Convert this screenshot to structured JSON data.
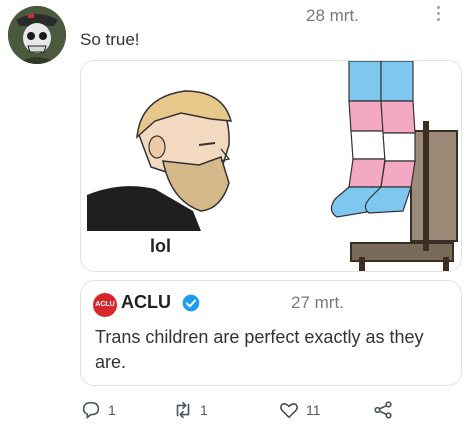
{
  "post": {
    "text": "So true!",
    "timestamp": "28 mrt.",
    "meme_caption": "lol"
  },
  "quoted": {
    "logo_text": "ACLU",
    "name": "ACLU",
    "timestamp": "27 mrt.",
    "text": "Trans children are perfect exactly as they are."
  },
  "actions": {
    "replies": "1",
    "retweets": "1",
    "likes": "11"
  },
  "colors": {
    "verified": "#1d9bf0",
    "aclu_red": "#d8262d",
    "trans_blue": "#7ec8f0",
    "trans_pink": "#f3a8c3"
  }
}
